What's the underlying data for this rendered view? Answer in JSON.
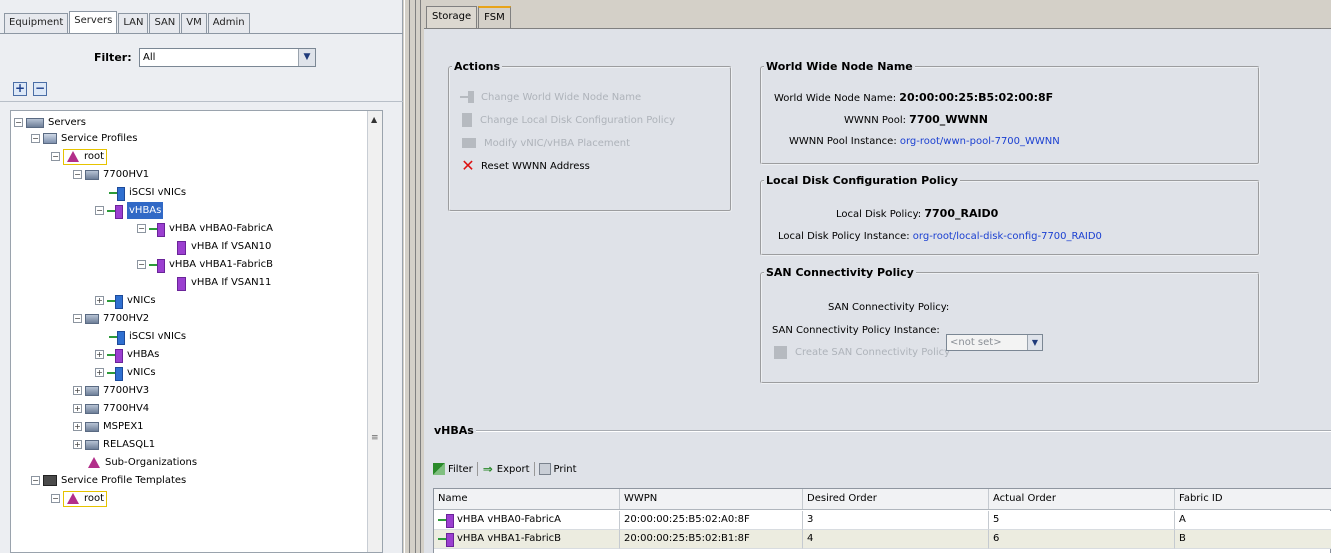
{
  "nav_tabs": [
    "Equipment",
    "Servers",
    "LAN",
    "SAN",
    "VM",
    "Admin"
  ],
  "nav_active": "Servers",
  "filter": {
    "label": "Filter:",
    "value": "All"
  },
  "tree": [
    "Servers",
    "Service Profiles",
    "root",
    "7700HV1",
    "iSCSI vNICs",
    "vHBAs",
    "vHBA vHBA0-FabricA",
    "vHBA If VSAN10",
    "vHBA vHBA1-FabricB",
    "vHBA If VSAN11",
    "vNICs",
    "7700HV2",
    "iSCSI vNICs",
    "vHBAs",
    "vNICs",
    "7700HV3",
    "7700HV4",
    "MSPEX1",
    "RELASQL1",
    "Sub-Organizations",
    "Service Profile Templates",
    "root"
  ],
  "right_tabs": [
    "Storage",
    "FSM"
  ],
  "right_tab_active": "Storage",
  "actions": {
    "title": "Actions",
    "items": [
      "Change World Wide Node Name",
      "Change Local Disk Configuration Policy",
      "Modify vNIC/vHBA Placement",
      "Reset WWNN Address"
    ]
  },
  "wwnn": {
    "title": "World Wide Node Name",
    "name_label": "World Wide Node Name:",
    "name_value": "20:00:00:25:B5:02:00:8F",
    "pool_label": "WWNN Pool:",
    "pool_value": "7700_WWNN",
    "instance_label": "WWNN Pool Instance:",
    "instance_value": "org-root/wwn-pool-7700_WWNN"
  },
  "local_disk": {
    "title": "Local Disk Configuration Policy",
    "policy_label": "Local Disk Policy:",
    "policy_value": "7700_RAID0",
    "instance_label": "Local Disk Policy Instance:",
    "instance_value": "org-root/local-disk-config-7700_RAID0"
  },
  "san": {
    "title": "SAN Connectivity Policy",
    "policy_label": "SAN Connectivity Policy:",
    "policy_value": "<not set>",
    "instance_label": "SAN Connectivity Policy Instance:",
    "create_label": "Create SAN Connectivity Policy"
  },
  "vhbas": {
    "title": "vHBAs",
    "toolbar": [
      "Filter",
      "Export",
      "Print"
    ],
    "columns": [
      "Name",
      "WWPN",
      "Desired Order",
      "Actual Order",
      "Fabric ID"
    ],
    "rows": [
      [
        "vHBA vHBA0-FabricA",
        "20:00:00:25:B5:02:A0:8F",
        "3",
        "5",
        "A"
      ],
      [
        "vHBA vHBA1-FabricB",
        "20:00:00:25:B5:02:B1:8F",
        "4",
        "6",
        "B"
      ]
    ]
  }
}
